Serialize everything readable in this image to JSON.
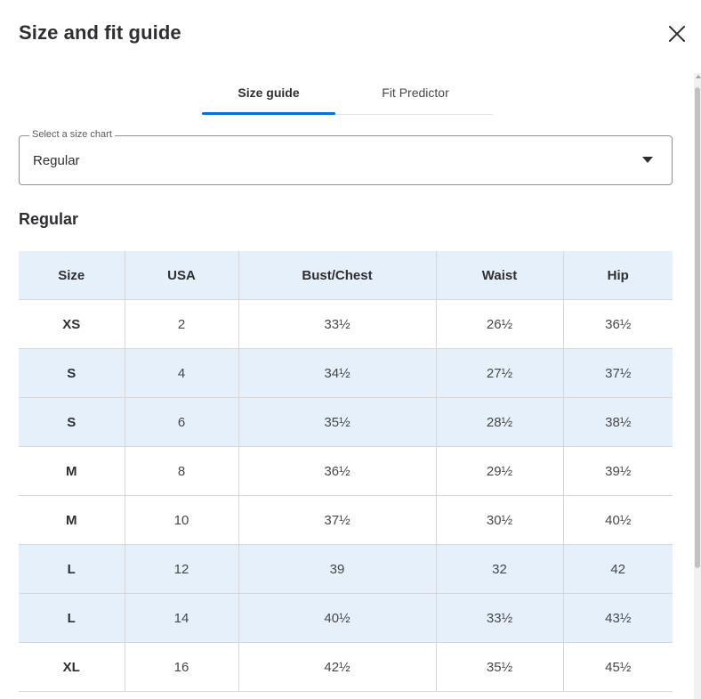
{
  "modal": {
    "title": "Size and fit guide",
    "close_icon": "close-icon"
  },
  "tabs": [
    {
      "label": "Size guide",
      "active": true
    },
    {
      "label": "Fit Predictor",
      "active": false
    }
  ],
  "size_chart_select": {
    "label": "Select a size chart",
    "value": "Regular"
  },
  "section": {
    "heading": "Regular"
  },
  "table": {
    "headers": [
      "Size",
      "USA",
      "Bust/Chest",
      "Waist",
      "Hip"
    ],
    "rows": [
      [
        "XS",
        "2",
        "33½",
        "26½",
        "36½"
      ],
      [
        "S",
        "4",
        "34½",
        "27½",
        "37½"
      ],
      [
        "S",
        "6",
        "35½",
        "28½",
        "38½"
      ],
      [
        "M",
        "8",
        "36½",
        "29½",
        "39½"
      ],
      [
        "M",
        "10",
        "37½",
        "30½",
        "40½"
      ],
      [
        "L",
        "12",
        "39",
        "32",
        "42"
      ],
      [
        "L",
        "14",
        "40½",
        "33½",
        "43½"
      ],
      [
        "XL",
        "16",
        "42½",
        "35½",
        "45½"
      ]
    ],
    "shaded_rows": [
      false,
      true,
      true,
      false,
      false,
      true,
      true,
      false
    ]
  },
  "colors": {
    "accent": "#0071dc",
    "header_bg": "#e5f0fb",
    "text": "#2e2f32"
  }
}
